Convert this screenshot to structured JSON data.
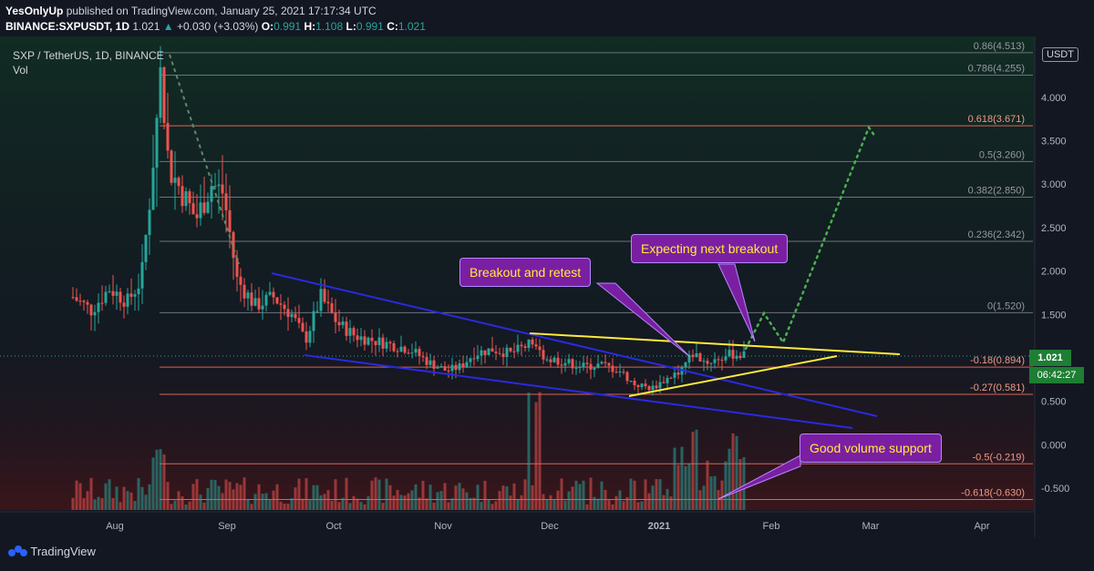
{
  "header": {
    "line1_user": "YesOnlyUp",
    "line1_rest": " published on TradingView.com, January 25, 2021 17:17:34 UTC",
    "symbol": "BINANCE:SXPUSDT, 1D",
    "last": "1.021",
    "change": "+0.030 (+3.03%)",
    "o_label": "O:",
    "o": "0.991",
    "h_label": "H:",
    "h": "1.108",
    "l_label": "L:",
    "l": "0.991",
    "c_label": "C:",
    "c": "1.021"
  },
  "legend": {
    "title": "SXP / TetherUS, 1D, BINANCE",
    "vol": "Vol"
  },
  "currency_badge": "USDT",
  "price_tag": "1.021",
  "timer_tag": "06:42:27",
  "callouts": {
    "breakout_retest": "Breakout and retest",
    "next_breakout": "Expecting next breakout",
    "volume_support": "Good volume support"
  },
  "footer": {
    "brand": "TradingView"
  },
  "colors": {
    "bg": "#131722",
    "up": "#26a69a",
    "down": "#ef5350",
    "blue": "#2a2ae0",
    "yellow": "#ffeb3b",
    "green_dots": "#4caf50",
    "callout": "#7b1fa2"
  },
  "chart_data": {
    "type": "candlestick",
    "title": "SXP / TetherUS, 1D, BINANCE",
    "x_ticks": [
      "Aug",
      "Sep",
      "Oct",
      "Nov",
      "Dec",
      "2021",
      "Feb",
      "Mar",
      "Apr"
    ],
    "y_ticks": [
      "4.000",
      "3.500",
      "3.000",
      "2.500",
      "2.000",
      "1.500",
      "1.000",
      "0.500",
      "0.000",
      "-0.500"
    ],
    "ylim": [
      -0.7,
      4.6
    ],
    "fib_levels": [
      {
        "label": "0.86(4.513)",
        "ratio": 0.86,
        "value": 4.513
      },
      {
        "label": "0.786(4.255)",
        "ratio": 0.786,
        "value": 4.255
      },
      {
        "label": "0.618(3.671)",
        "ratio": 0.618,
        "value": 3.671
      },
      {
        "label": "0.5(3.260)",
        "ratio": 0.5,
        "value": 3.26
      },
      {
        "label": "0.382(2.850)",
        "ratio": 0.382,
        "value": 2.85
      },
      {
        "label": "0.236(2.342)",
        "ratio": 0.236,
        "value": 2.342
      },
      {
        "label": "0(1.520)",
        "ratio": 0,
        "value": 1.52
      },
      {
        "label": "-0.18(0.894)",
        "ratio": -0.18,
        "value": 0.894
      },
      {
        "label": "-0.27(0.581)",
        "ratio": -0.27,
        "value": 0.581
      },
      {
        "label": "-0.5(-0.219)",
        "ratio": -0.5,
        "value": -0.219
      },
      {
        "label": "-0.618(-0.630)",
        "ratio": -0.618,
        "value": -0.63
      }
    ],
    "last_price": 1.021
  }
}
